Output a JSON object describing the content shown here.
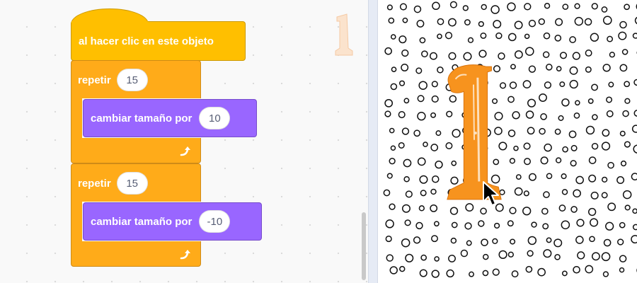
{
  "code_area": {
    "hat_block": {
      "label": "al hacer clic en este objeto"
    },
    "repeat_blocks": [
      {
        "label": "repetir",
        "count": "15",
        "inner": {
          "label": "cambiar tamaño por",
          "value": "10"
        }
      },
      {
        "label": "repetir",
        "count": "15",
        "inner": {
          "label": "cambiar tamaño por",
          "value": "-10"
        }
      }
    ]
  },
  "colors": {
    "events": "#ffbf00",
    "control": "#ffab19",
    "looks": "#9966ff",
    "sprite": "#f7931e"
  },
  "icons": [
    "repeat-arrow-icon",
    "mouse-pointer-icon",
    "letter-l-sprite"
  ]
}
